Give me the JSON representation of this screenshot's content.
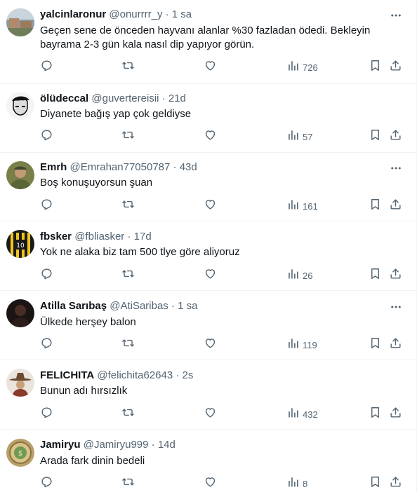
{
  "tweets": [
    {
      "name": "yalcinlaronur",
      "handle": "@onurrrr_y",
      "time": "1 sa",
      "text": "Geçen sene de önceden hayvanı alanlar %30 fazladan ödedi. Bekleyin bayrama 2-3 gün kala nasıl dip yapıyor görün.",
      "views": "726",
      "avatar": "avatar-village-photo"
    },
    {
      "name": "ölüdeccal",
      "handle": "@guvertereisii",
      "time": "21d",
      "text": "Diyanete bağış yap çok geldiyse",
      "views": "57",
      "avatar": "avatar-sketch-portrait"
    },
    {
      "name": "Emrh",
      "handle": "@Emrahan77050787",
      "time": "43d",
      "text": "Boş konuşuyorsun şuan",
      "views": "161",
      "avatar": "avatar-soldier"
    },
    {
      "name": "fbsker",
      "handle": "@fbliasker",
      "time": "17d",
      "text": "Yok ne alaka biz tam 500 tlye göre aliyoruz",
      "views": "26",
      "avatar": "avatar-fenerbahce-jersey"
    },
    {
      "name": "Atilla Sarıbaş",
      "handle": "@AtiSaribas",
      "time": "1 sa",
      "text": "Ülkede herşey balon",
      "views": "119",
      "avatar": "avatar-dark-portrait"
    },
    {
      "name": "FELICHITA",
      "handle": "@felichita62643",
      "time": "2s",
      "text": "Bunun adı hırsızlık",
      "views": "432",
      "avatar": "avatar-cowboy"
    },
    {
      "name": "Jamiryu",
      "handle": "@Jamiryu999",
      "time": "14d",
      "text": "Arada fark dinin bedeli",
      "views": "8",
      "avatar": "avatar-coin"
    }
  ],
  "separator": "·",
  "colors": {
    "text": "#0f1419",
    "secondary": "#536471",
    "border": "#eff3f4"
  },
  "icons": {
    "reply": "reply-icon",
    "retweet": "retweet-icon",
    "like": "like-icon",
    "views": "views-icon",
    "bookmark": "bookmark-icon",
    "share": "share-icon",
    "more": "more-icon"
  }
}
